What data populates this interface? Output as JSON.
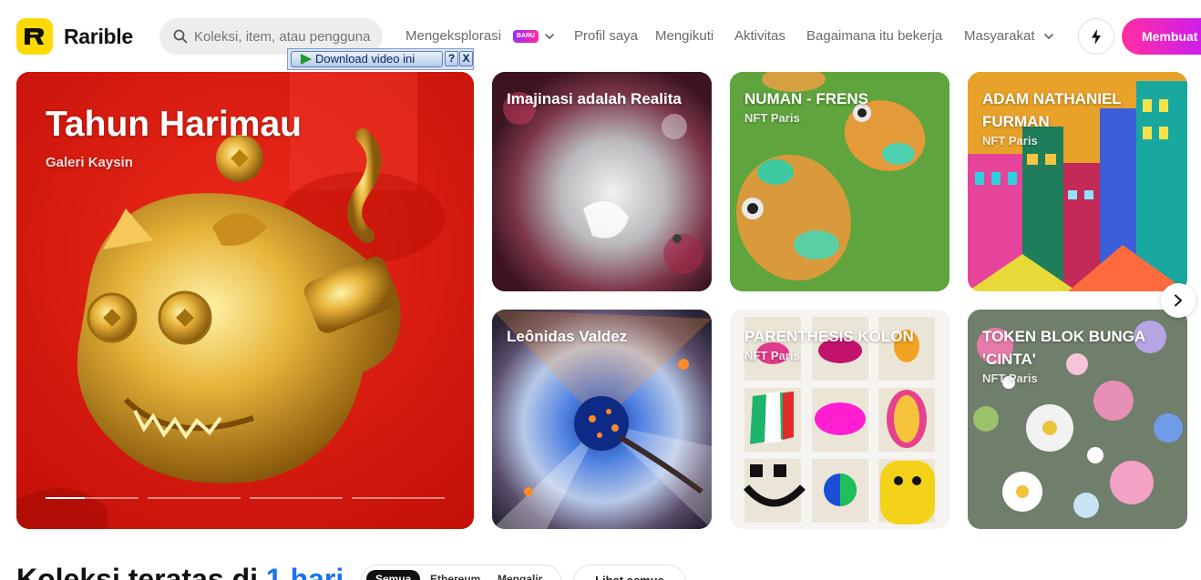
{
  "header": {
    "brand": "Rarible",
    "search_placeholder": "Koleksi, item, atau pengguna",
    "nav": [
      {
        "label": "Mengeksplorasi"
      },
      {
        "label": "Profil saya"
      },
      {
        "label": "Mengikuti"
      },
      {
        "label": "Aktivitas"
      },
      {
        "label": "Bagaimana itu bekerja"
      },
      {
        "label": "Masyarakat"
      }
    ],
    "new_badge": "BARU",
    "create_label": "Membuat"
  },
  "download_toolbar": {
    "label": "Download video ini",
    "help": "?",
    "close": "X"
  },
  "hero": {
    "title": "Tahun Harimau",
    "subtitle": "Galeri Kaysin",
    "slides": [
      {
        "progress": 0.42
      },
      {
        "progress": 0
      },
      {
        "progress": 0
      },
      {
        "progress": 0
      }
    ]
  },
  "cards": [
    {
      "title": "Imajinasi adalah Realita",
      "subtitle": ""
    },
    {
      "title": "NUMAN - FRENS",
      "subtitle": "NFT Paris"
    },
    {
      "title": "ADAM NATHANIEL FURMAN",
      "subtitle": "NFT Paris"
    },
    {
      "title": "Leônidas Valdez",
      "subtitle": ""
    },
    {
      "title": "PARENTHESIS KOLON",
      "subtitle": "NFT Paris"
    },
    {
      "title": "TOKEN BLOK BUNGA 'CINTA'",
      "subtitle": "NFT Paris"
    }
  ],
  "section": {
    "title_prefix": "Koleksi teratas di",
    "title_accent": "1 hari",
    "filters": [
      "Semua",
      "Ethereum",
      "Mengalir"
    ],
    "see_all": "Lihat semua"
  },
  "colors": {
    "brand_yellow": "#FEDA03",
    "create_gradient": [
      "#ff2ea0",
      "#c21aff"
    ],
    "accent_blue": "#1a73e8"
  }
}
